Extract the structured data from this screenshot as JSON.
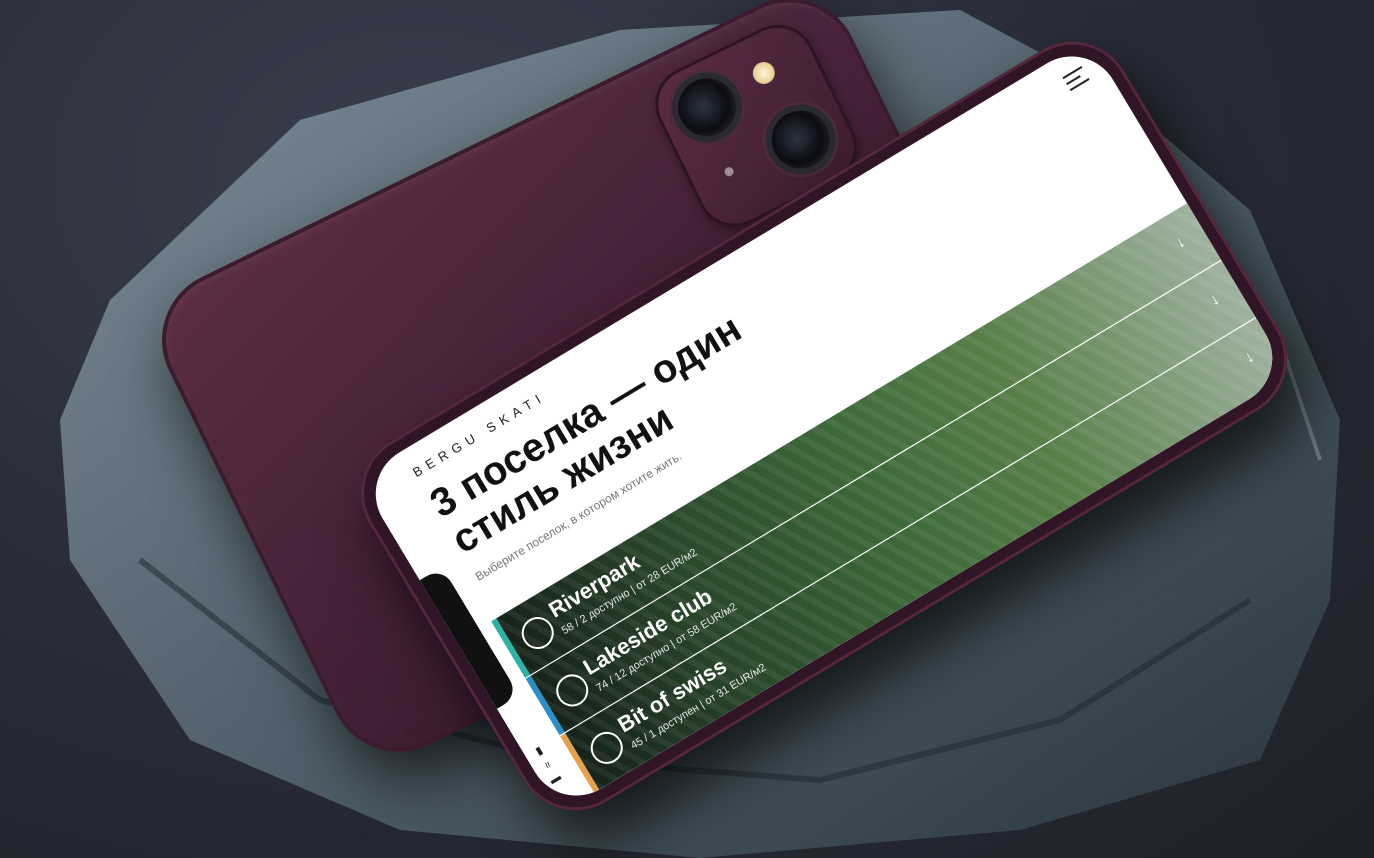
{
  "status": {
    "time": "13:21"
  },
  "brand": "BERGU SKATI",
  "headline": "3 поселка — один стиль жизни",
  "subtitle": "Выберите поселок, в котором хотите жить.",
  "colors": {
    "phone": "#47223a",
    "card1": "#2bb3a3",
    "card2": "#2a8fc7",
    "card3": "#e6a24a"
  },
  "cards": [
    {
      "name": "Riverpark",
      "availability": "58 / 2 доступно",
      "price": "от 28 EUR/м2",
      "arrow": "↓"
    },
    {
      "name": "Lakeside club",
      "availability": "74 / 12 доступно",
      "price": "от 58 EUR/м2",
      "arrow": "↓"
    },
    {
      "name": "Bit of swiss",
      "availability": "45 / 1 доступен",
      "price": "от 31 EUR/м2",
      "arrow": "↓"
    }
  ]
}
